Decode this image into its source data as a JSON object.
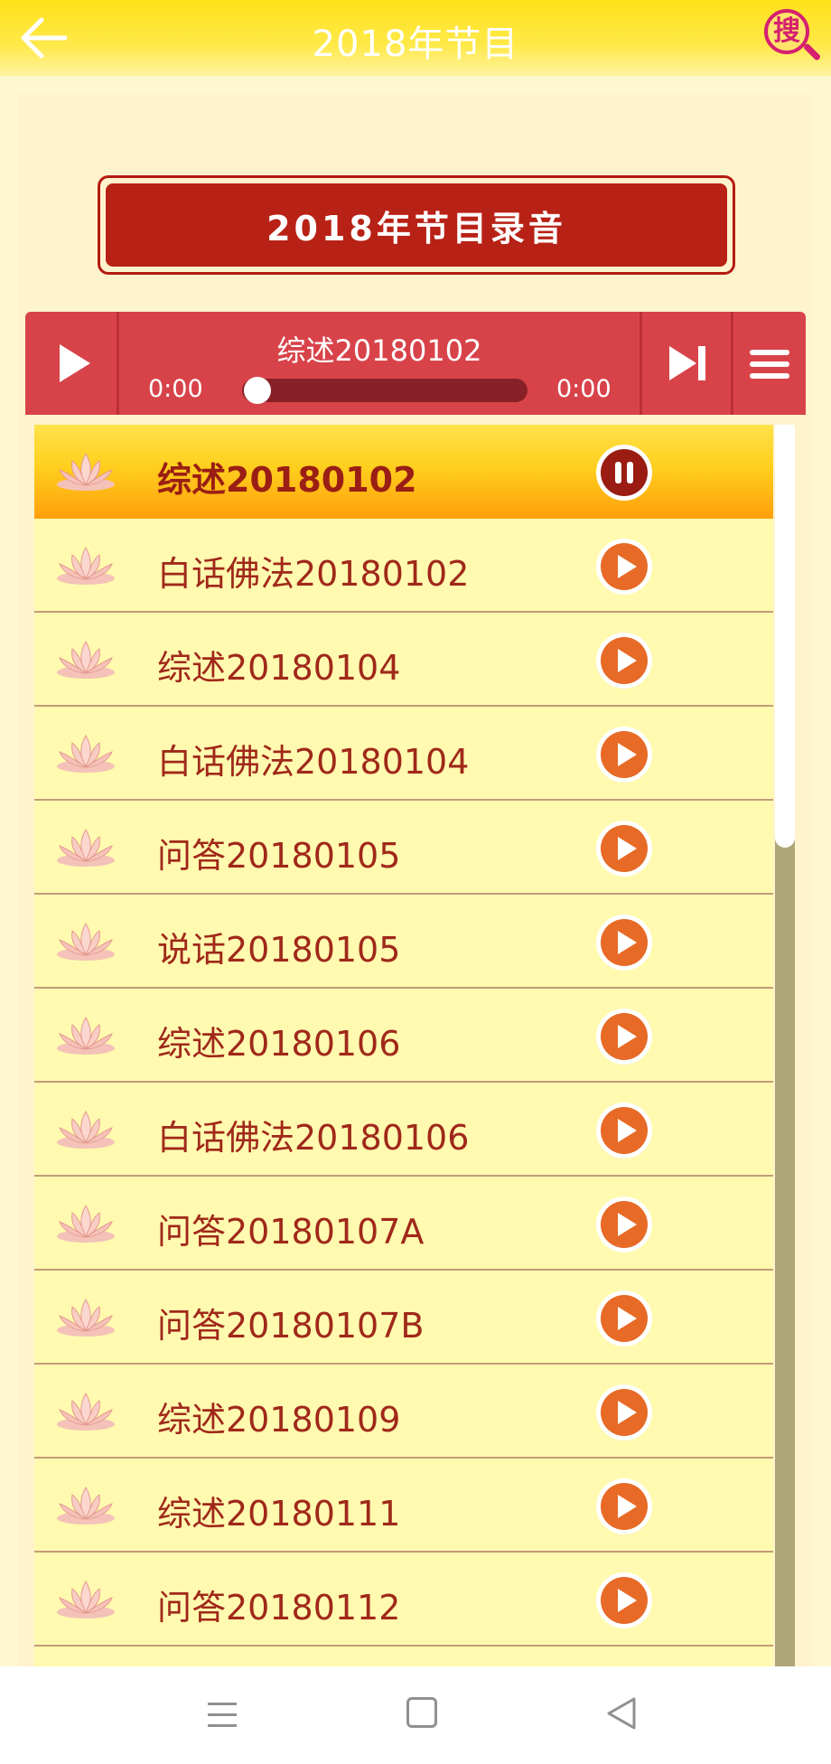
{
  "header": {
    "title": "2018年节目",
    "back_icon": "arrow-left-icon",
    "search_label": "搜"
  },
  "banner": {
    "label": "2018年节目录音"
  },
  "player": {
    "track_title": "综述20180102",
    "current_time": "0:00",
    "duration": "0:00",
    "progress": 0,
    "accent_color": "#d8434a"
  },
  "list": {
    "active_index": 0,
    "items": [
      {
        "label": "综述20180102",
        "state": "playing"
      },
      {
        "label": "白话佛法20180102",
        "state": "idle"
      },
      {
        "label": "综述20180104",
        "state": "idle"
      },
      {
        "label": "白话佛法20180104",
        "state": "idle"
      },
      {
        "label": "问答20180105",
        "state": "idle"
      },
      {
        "label": "说话20180105",
        "state": "idle"
      },
      {
        "label": "综述20180106",
        "state": "idle"
      },
      {
        "label": "白话佛法20180106",
        "state": "idle"
      },
      {
        "label": "问答20180107A",
        "state": "idle"
      },
      {
        "label": "问答20180107B",
        "state": "idle"
      },
      {
        "label": "综述20180109",
        "state": "idle"
      },
      {
        "label": "综述20180111",
        "state": "idle"
      },
      {
        "label": "问答20180112",
        "state": "idle"
      },
      {
        "label": "",
        "state": "idle"
      }
    ]
  },
  "colors": {
    "topbar": "#ffe21a",
    "banner": "#b82115",
    "row_bg": "#fffaaf",
    "row_text": "#a0281a",
    "play_button": "#e76a26",
    "pause_button": "#9a1c12"
  },
  "navbar": {
    "menu_icon": "menu-lines-icon",
    "home_icon": "square-home-icon",
    "back_icon": "triangle-back-icon"
  }
}
